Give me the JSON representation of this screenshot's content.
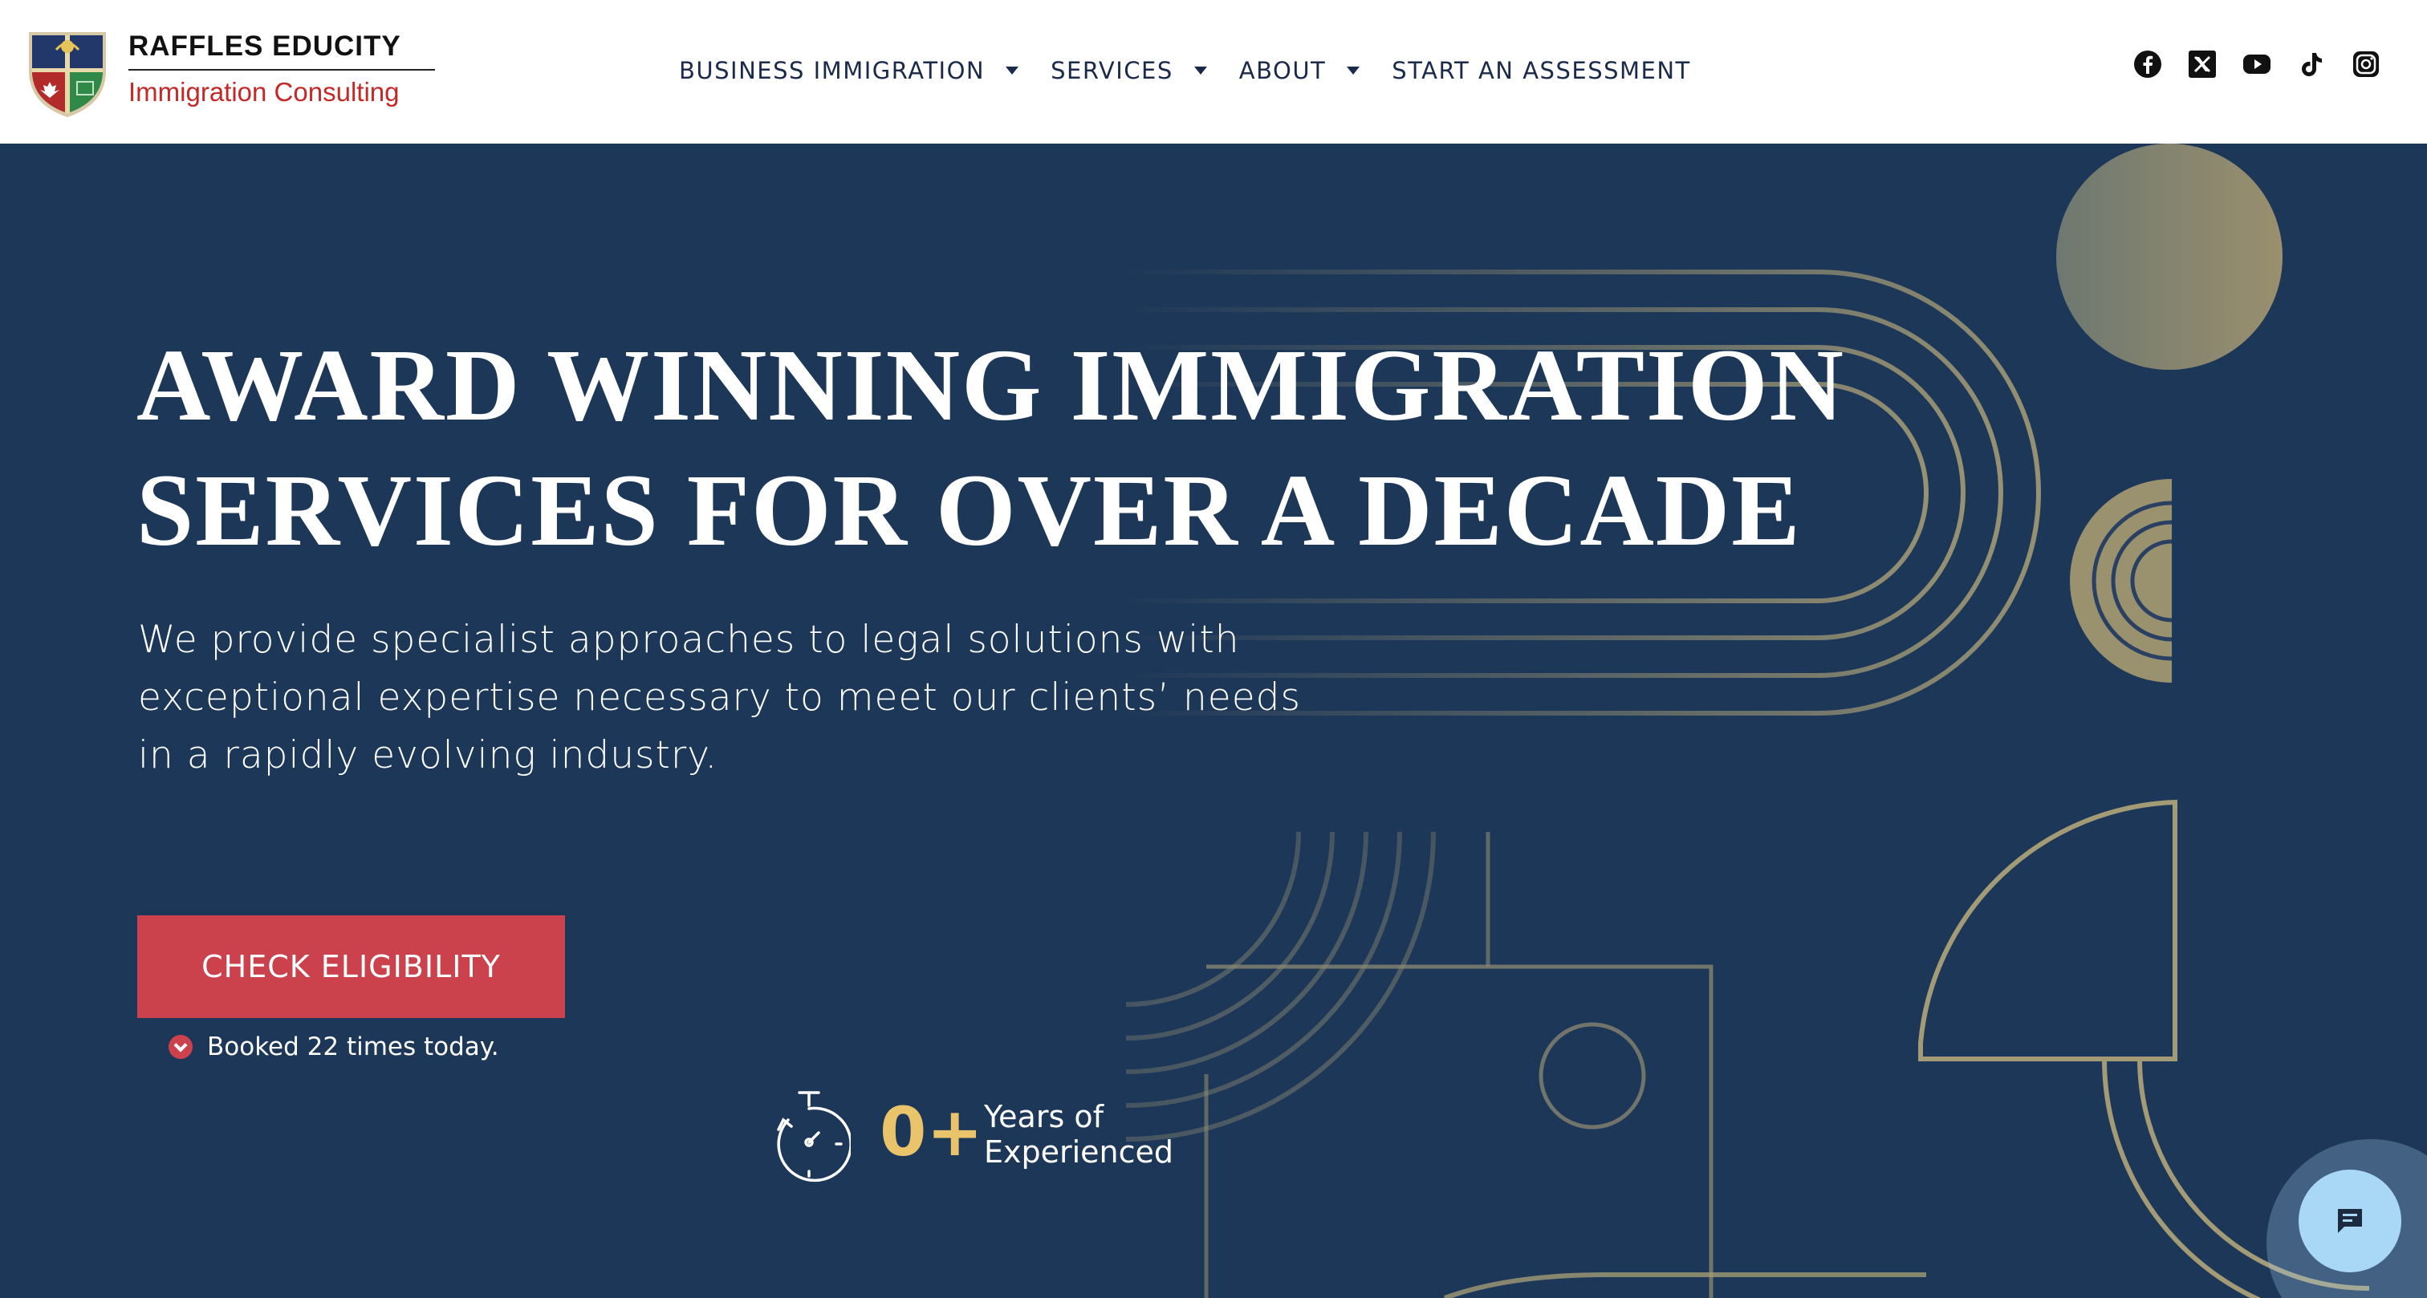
{
  "brand": {
    "name": "RAFFLES EDUCITY",
    "tagline": "Immigration Consulting"
  },
  "nav": {
    "items": [
      {
        "label": "BUSINESS IMMIGRATION",
        "has_dropdown": true
      },
      {
        "label": "SERVICES",
        "has_dropdown": true
      },
      {
        "label": "ABOUT",
        "has_dropdown": true
      },
      {
        "label": "START AN ASSESSMENT",
        "has_dropdown": false
      }
    ]
  },
  "social": [
    "facebook-icon",
    "x-twitter-icon",
    "youtube-icon",
    "tiktok-icon",
    "instagram-icon"
  ],
  "hero": {
    "title_line1": "AWARD WINNING IMMIGRATION",
    "title_line2": "SERVICES FOR OVER A DECADE",
    "desc_line1": "We provide specialist approaches to legal solutions with",
    "desc_line2": "exceptional expertise necessary to meet our clients’ needs",
    "desc_line3": "in a rapidly evolving industry.",
    "cta_label": "CHECK ELIGIBILITY",
    "booked_text": "Booked 22 times today.",
    "stat_value": "0+",
    "stat_label_line1": "Years of",
    "stat_label_line2": "Experienced"
  },
  "colors": {
    "hero_bg": "#1d3758",
    "cta": "#cb424c",
    "gold": "#a39b75",
    "stat_accent": "#e9c46a",
    "chat": "#a9d8f7"
  }
}
